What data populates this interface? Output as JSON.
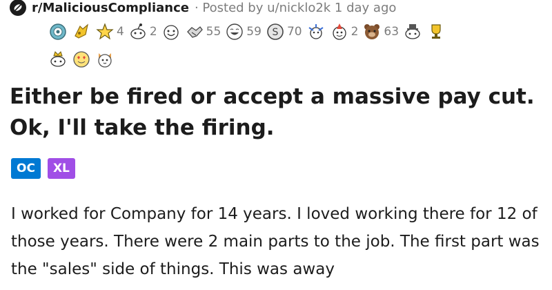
{
  "header": {
    "subreddit": "r/MaliciousCompliance",
    "posted_by": "· Posted by u/nicklo2k 1 day ago"
  },
  "awards": [
    {
      "icon": "hugz-icon",
      "count": ""
    },
    {
      "icon": "helpful-icon",
      "count": ""
    },
    {
      "icon": "star-icon",
      "count": "4"
    },
    {
      "icon": "snoo-award-icon",
      "count": "2"
    },
    {
      "icon": "wholesome-icon",
      "count": ""
    },
    {
      "icon": "handshake-icon",
      "count": "55"
    },
    {
      "icon": "laughing-icon",
      "count": "59"
    },
    {
      "icon": "silver-icon",
      "count": "70"
    },
    {
      "icon": "bravo-icon",
      "count": ""
    },
    {
      "icon": "party-icon",
      "count": "2"
    },
    {
      "icon": "bear-icon",
      "count": "63"
    },
    {
      "icon": "snoo-hat-icon",
      "count": ""
    },
    {
      "icon": "trophy-icon",
      "count": ""
    },
    {
      "icon": "snoo-crown-icon",
      "count": ""
    },
    {
      "icon": "heart-eyes-icon",
      "count": ""
    },
    {
      "icon": "cat-icon",
      "count": ""
    }
  ],
  "post": {
    "title": "Either be fired or accept a massive pay cut. Ok, I'll take the firing.",
    "flairs": [
      {
        "label": "OC",
        "color": "#0079d3"
      },
      {
        "label": "XL",
        "color": "#a04ee6"
      }
    ],
    "body": "I worked for Company for 14 years. I loved working there for 12 of those years. There were 2 main parts to the job. The first part was the \"sales\" side of things. This was away"
  }
}
